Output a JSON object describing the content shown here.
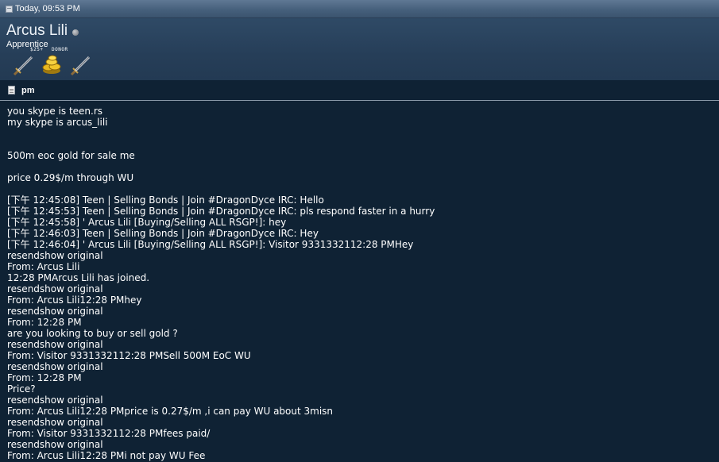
{
  "header": {
    "date": "Today, 09:53 PM"
  },
  "user": {
    "name": "Arcus Lili",
    "title": "Apprentice",
    "status": "offline",
    "awards": [
      {
        "icon": "sword-icon",
        "label": ""
      },
      {
        "icon": "gold-coins-icon",
        "label": "$25+ DONOR"
      },
      {
        "icon": "sword-icon",
        "label": ""
      }
    ],
    "award_label_1": "$25+",
    "award_label_2": "DONOR"
  },
  "post": {
    "title": "pm",
    "lines": [
      "you skype is teen.rs",
      "my skype is arcus_lili",
      "",
      "",
      "500m eoc gold for sale me",
      "",
      "price 0.29$/m through WU",
      "",
      "[下午 12:45:08] Teen | Selling Bonds | Join #DragonDyce IRC: Hello",
      "[下午 12:45:53] Teen | Selling Bonds | Join #DragonDyce IRC: pls respond faster in a hurry",
      "[下午 12:45:58] ' Arcus Lili [Buying/Selling ALL RSGP!]: hey",
      "[下午 12:46:03] Teen | Selling Bonds | Join #DragonDyce IRC: Hey",
      "[下午 12:46:04] ' Arcus Lili [Buying/Selling ALL RSGP!]: Visitor 9331332112:28 PMHey",
      "resendshow original",
      "From: Arcus Lili",
      "12:28 PMArcus Lili has joined.",
      "resendshow original",
      "From: Arcus Lili12:28 PMhey",
      "resendshow original",
      "From: 12:28 PM",
      "are you looking to buy or sell gold ?",
      "resendshow original",
      "From: Visitor 9331332112:28 PMSell 500M EoC WU",
      "resendshow original",
      "From: 12:28 PM",
      "Price?",
      "resendshow original",
      "From: Arcus Lili12:28 PMprice is 0.27$/m ,i can pay WU about 3misn",
      "resendshow original",
      "From: Visitor 9331332112:28 PMfees paid/",
      "resendshow original",
      "From: Arcus Lili12:28 PMi not pay WU Fee"
    ]
  }
}
